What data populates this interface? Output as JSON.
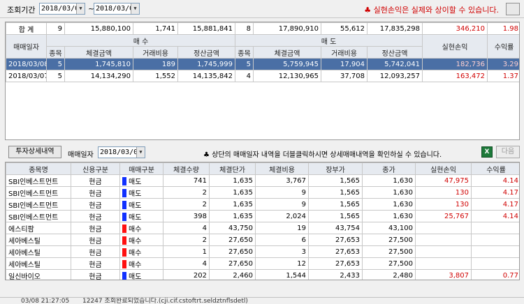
{
  "header": {
    "period_label": "조회기간",
    "date_from": "2018/03/07",
    "date_to": "2018/03/08",
    "separator": "~",
    "notice": "실현손익은 실제와 상이할 수 있습니다."
  },
  "summary": {
    "total_label": "합 계",
    "buy_count": "9",
    "buy_amount": "15,880,100",
    "buy_cost": "1,741",
    "buy_settle": "15,881,841",
    "sell_count": "8",
    "sell_amount": "17,890,910",
    "sell_cost": "55,612",
    "sell_settle": "17,835,298",
    "realized_pl": "346,210",
    "return_rate": "1.98"
  },
  "upper_headers": {
    "trade_date": "매매일자",
    "buy": "매 수",
    "sell": "매 도",
    "realized_pl": "실현손익",
    "return_rate": "수익률",
    "count": "종목",
    "amount": "체결금액",
    "cost": "거래비용",
    "settle": "정산금액"
  },
  "daily_rows": [
    {
      "date": "2018/03/08",
      "buy_count": "5",
      "buy_amount": "1,745,810",
      "buy_cost": "189",
      "buy_settle": "1,745,999",
      "sell_count": "5",
      "sell_amount": "5,759,945",
      "sell_cost": "17,904",
      "sell_settle": "5,742,041",
      "realized_pl": "182,736",
      "return_rate": "3.29"
    },
    {
      "date": "2018/03/07",
      "buy_count": "5",
      "buy_amount": "14,134,290",
      "buy_cost": "1,552",
      "buy_settle": "14,135,842",
      "sell_count": "4",
      "sell_amount": "12,130,965",
      "sell_cost": "37,708",
      "sell_settle": "12,093,257",
      "realized_pl": "163,472",
      "return_rate": "1.37"
    }
  ],
  "detail_bar": {
    "tab_label": "투자상세내역",
    "date_label": "매매일자",
    "date_value": "2018/03/08",
    "notice": "상단의 매매일자 내역을 더블클릭하시면 상세매매내역을 확인하실 수 있습니다.",
    "excel_label": "X",
    "next_label": "다음"
  },
  "lower_headers": [
    "종목명",
    "신용구분",
    "매매구분",
    "체결수량",
    "체결단가",
    "체결비용",
    "장부가",
    "종가",
    "실현손익",
    "수익률"
  ],
  "detail_rows": [
    {
      "name": "SBI인베스트먼트",
      "credit": "현금",
      "side": "매도",
      "side_type": "sell",
      "qty": "741",
      "price": "1,635",
      "cost": "3,767",
      "book": "1,565",
      "close": "1,630",
      "pl": "47,975",
      "rate": "4.14"
    },
    {
      "name": "SBI인베스트먼트",
      "credit": "현금",
      "side": "매도",
      "side_type": "sell",
      "qty": "2",
      "price": "1,635",
      "cost": "9",
      "book": "1,565",
      "close": "1,630",
      "pl": "130",
      "rate": "4.17"
    },
    {
      "name": "SBI인베스트먼트",
      "credit": "현금",
      "side": "매도",
      "side_type": "sell",
      "qty": "2",
      "price": "1,635",
      "cost": "9",
      "book": "1,565",
      "close": "1,630",
      "pl": "130",
      "rate": "4.17"
    },
    {
      "name": "SBI인베스트먼트",
      "credit": "현금",
      "side": "매도",
      "side_type": "sell",
      "qty": "398",
      "price": "1,635",
      "cost": "2,024",
      "book": "1,565",
      "close": "1,630",
      "pl": "25,767",
      "rate": "4.14"
    },
    {
      "name": "에스티팜",
      "credit": "현금",
      "side": "매수",
      "side_type": "buy",
      "qty": "4",
      "price": "43,750",
      "cost": "19",
      "book": "43,754",
      "close": "43,100",
      "pl": "",
      "rate": ""
    },
    {
      "name": "세아베스틸",
      "credit": "현금",
      "side": "매수",
      "side_type": "buy",
      "qty": "2",
      "price": "27,650",
      "cost": "6",
      "book": "27,653",
      "close": "27,500",
      "pl": "",
      "rate": ""
    },
    {
      "name": "세아베스틸",
      "credit": "현금",
      "side": "매수",
      "side_type": "buy",
      "qty": "1",
      "price": "27,650",
      "cost": "3",
      "book": "27,653",
      "close": "27,500",
      "pl": "",
      "rate": ""
    },
    {
      "name": "세아베스틸",
      "credit": "현금",
      "side": "매수",
      "side_type": "buy",
      "qty": "4",
      "price": "27,650",
      "cost": "12",
      "book": "27,653",
      "close": "27,500",
      "pl": "",
      "rate": ""
    },
    {
      "name": "일신바이오",
      "credit": "현금",
      "side": "매도",
      "side_type": "sell",
      "qty": "202",
      "price": "2,460",
      "cost": "1,544",
      "book": "2,433",
      "close": "2,480",
      "pl": "3,807",
      "rate": "0.77"
    }
  ],
  "status": {
    "time": "03/08 21:27:05",
    "message": "12247 조회완료되었습니다.(cji.cif.cstoftrt.seldztnflsdetl)"
  }
}
